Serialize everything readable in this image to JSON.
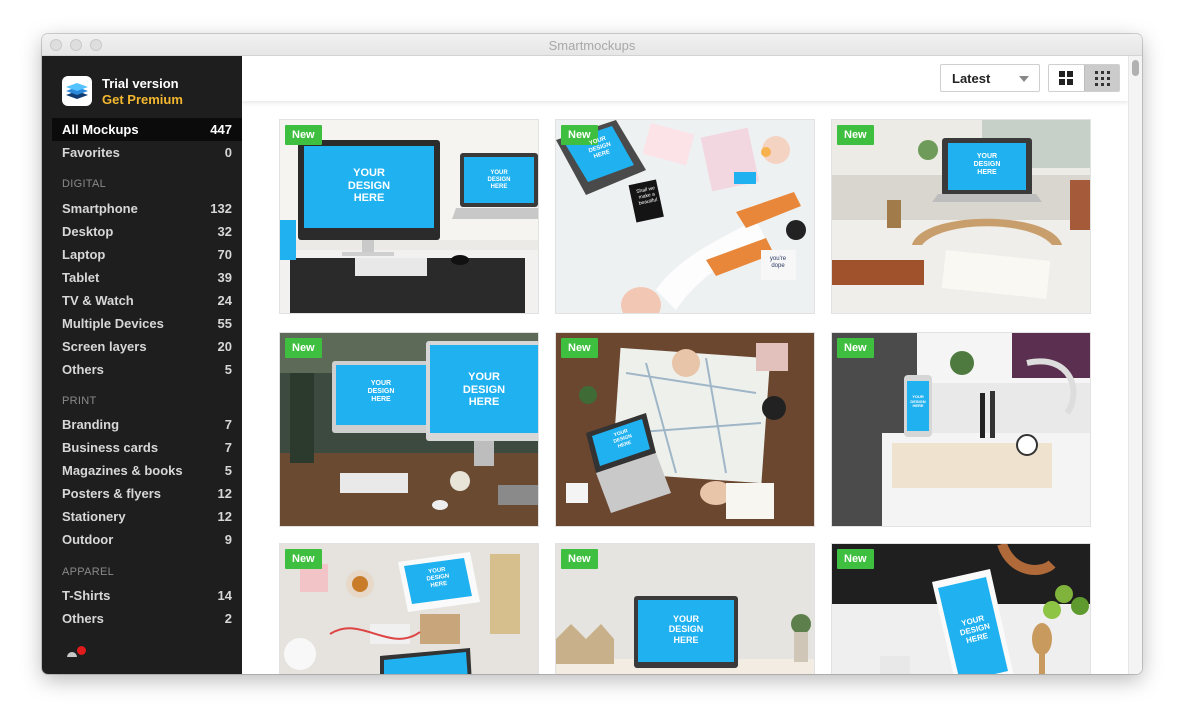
{
  "window": {
    "title": "Smartmockups"
  },
  "brand": {
    "title": "Trial version",
    "premium": "Get Premium",
    "logo_icon": "layers-stack-icon"
  },
  "sidebar": {
    "top": [
      {
        "label": "All Mockups",
        "count": "447",
        "active": true
      },
      {
        "label": "Favorites",
        "count": "0"
      }
    ],
    "sections": [
      {
        "title": "DIGITAL",
        "items": [
          {
            "label": "Smartphone",
            "count": "132"
          },
          {
            "label": "Desktop",
            "count": "32"
          },
          {
            "label": "Laptop",
            "count": "70"
          },
          {
            "label": "Tablet",
            "count": "39"
          },
          {
            "label": "TV & Watch",
            "count": "24"
          },
          {
            "label": "Multiple Devices",
            "count": "55"
          },
          {
            "label": "Screen layers",
            "count": "20"
          },
          {
            "label": "Others",
            "count": "5"
          }
        ]
      },
      {
        "title": "PRINT",
        "items": [
          {
            "label": "Branding",
            "count": "7"
          },
          {
            "label": "Business cards",
            "count": "7"
          },
          {
            "label": "Magazines & books",
            "count": "5"
          },
          {
            "label": "Posters & flyers",
            "count": "12"
          },
          {
            "label": "Stationery",
            "count": "12"
          },
          {
            "label": "Outdoor",
            "count": "9"
          }
        ]
      },
      {
        "title": "APPAREL",
        "items": [
          {
            "label": "T-Shirts",
            "count": "14"
          },
          {
            "label": "Others",
            "count": "2"
          }
        ]
      }
    ]
  },
  "toolbar": {
    "sort_value": "Latest",
    "view_large_icon": "grid-large-icon",
    "view_small_icon": "grid-small-icon",
    "view_active": "small"
  },
  "mockups": [
    {
      "badge": "New",
      "scene": "Desktop monitor and laptop on desk",
      "screen_lines": [
        "YOUR",
        "DESIGN",
        "HERE"
      ],
      "screen_lines_2": [
        "YOUR",
        "DESIGN",
        "HERE"
      ]
    },
    {
      "badge": "New",
      "scene": "Laptop on white flatlay with sneakers",
      "screen_lines": [
        "YOUR",
        "DESIGN",
        "HERE"
      ],
      "prints": [
        "Shall we",
        "make a",
        "beautiful",
        "you're",
        "dope"
      ]
    },
    {
      "badge": "New",
      "scene": "Laptop on wooden stand by window",
      "screen_lines": [
        "YOUR",
        "DESIGN",
        "HERE"
      ]
    },
    {
      "badge": "New",
      "scene": "Dual monitors on wooden desk",
      "screen_lines": [
        "YOUR",
        "DESIGN",
        "HERE"
      ],
      "screen_lines_2": [
        "YOUR",
        "DESIGN",
        "HERE"
      ]
    },
    {
      "badge": "New",
      "scene": "Laptop on map with travel items",
      "screen_lines": [
        "YOUR",
        "DESIGN",
        "HERE"
      ]
    },
    {
      "badge": "New",
      "scene": "Smartphone in desk organizer",
      "screen_lines": [
        "YOUR",
        "DESIGN",
        "HERE"
      ]
    },
    {
      "badge": "New",
      "scene": "Tablet on crafting table",
      "screen_lines": [
        "YOUR",
        "DESIGN",
        "HERE"
      ]
    },
    {
      "badge": "New",
      "scene": "Laptop on minimal desk",
      "screen_lines": [
        "YOUR",
        "DESIGN",
        "HERE"
      ]
    },
    {
      "badge": "New",
      "scene": "Smartphone on kitchen counter",
      "screen_lines": [
        "YOUR",
        "DESIGN",
        "HERE"
      ]
    }
  ],
  "colors": {
    "screen_blue": "#1fb1f0",
    "badge_green": "#3fbf3f",
    "premium_yellow": "#f3b82f",
    "sidebar_bg": "#1e1e1e"
  }
}
